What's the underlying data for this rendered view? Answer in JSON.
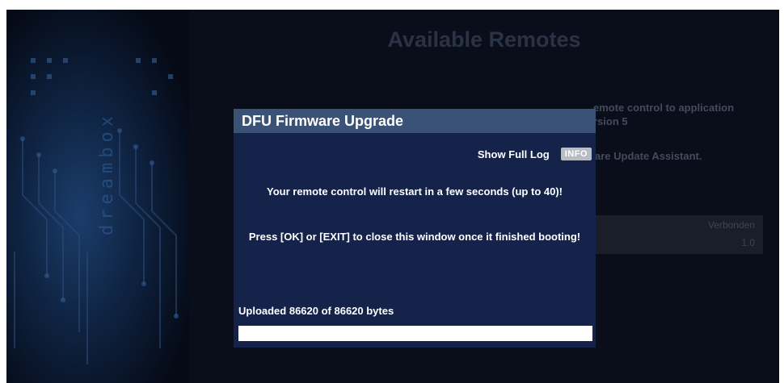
{
  "brand": {
    "logo_text": "dreambox"
  },
  "background": {
    "title": "Available Remotes",
    "text_line1": "emote control to application",
    "text_line1b": "rsion 5",
    "text_line2": "are Update Assistant.",
    "table_header": "Verbonden",
    "table_value": "1.0"
  },
  "dialog": {
    "title": "DFU Firmware Upgrade",
    "show_log_label": "Show Full Log",
    "info_key": "INFO",
    "message1": "Your remote control will restart in a few seconds (up to 40)!",
    "message2": "Press [OK] or [EXIT] to close this window once it finished booting!",
    "upload_status": "Uploaded 86620 of 86620 bytes",
    "progress": 1.0
  },
  "colors": {
    "dialog_bg": "#15234a",
    "title_bar": "#3b5277",
    "progress_fill": "#ffffff"
  }
}
